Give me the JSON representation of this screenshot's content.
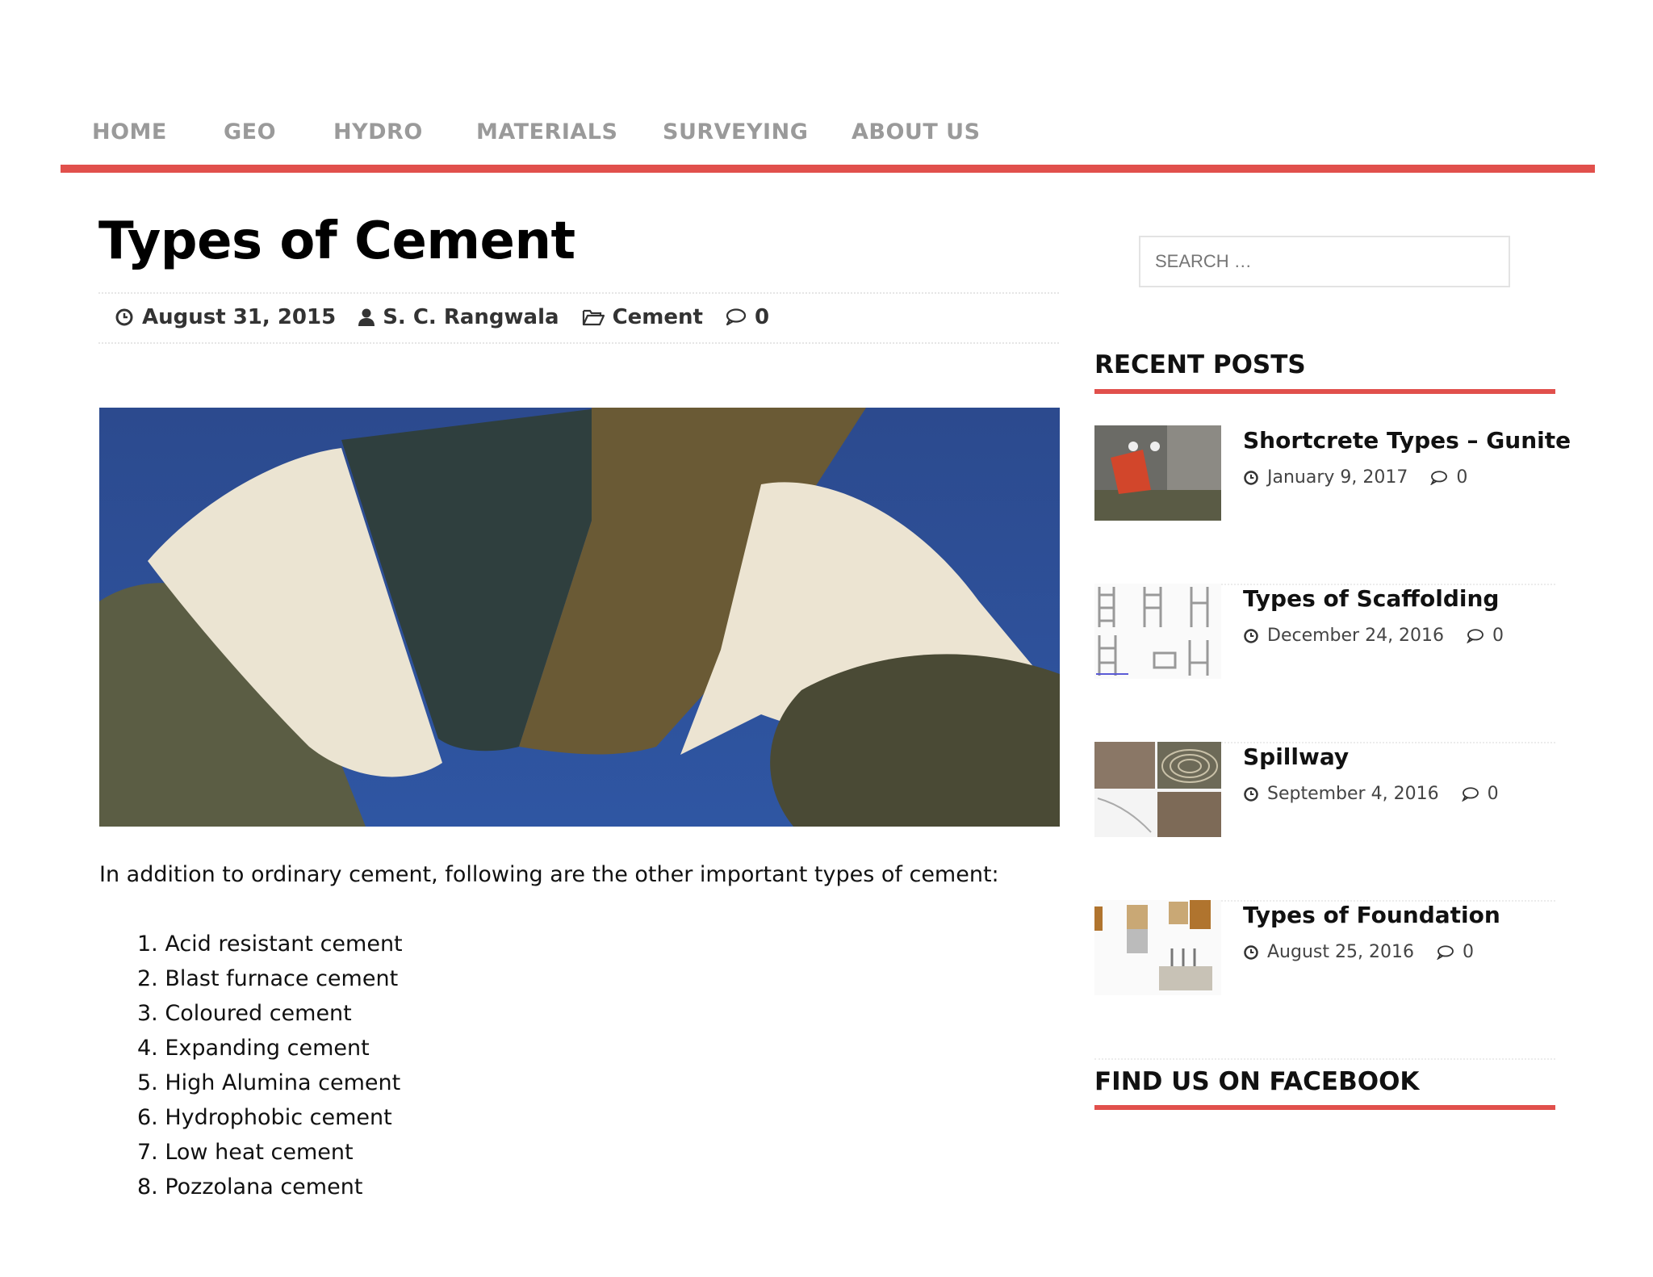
{
  "nav": {
    "items": [
      {
        "label": "HOME"
      },
      {
        "label": "GEO"
      },
      {
        "label": "HYDRO"
      },
      {
        "label": "MATERIALS"
      },
      {
        "label": "SURVEYING"
      },
      {
        "label": "ABOUT US"
      }
    ],
    "accent": "#e1504c"
  },
  "article": {
    "title": "Types of Cement",
    "meta": {
      "date": "August 31, 2015",
      "author": "S. C. Rangwala",
      "category": "Cement",
      "comments": "0"
    },
    "intro": "In addition to ordinary cement, following are the other important types of cement:",
    "list": [
      "1. Acid resistant cement",
      "2. Blast furnace cement",
      "3. Coloured cement",
      "4. Expanding cement",
      "5. High Alumina cement",
      "6. Hydrophobic cement",
      "7. Low heat cement",
      "8. Pozzolana cement"
    ]
  },
  "sidebar": {
    "search_placeholder": "SEARCH …",
    "recent_title": "RECENT POSTS",
    "posts": [
      {
        "title": "Shortcrete Types – Gunite",
        "date": "January 9, 2017",
        "comments": "0"
      },
      {
        "title": "Types of Scaffolding",
        "date": "December 24, 2016",
        "comments": "0"
      },
      {
        "title": "Spillway",
        "date": "September 4, 2016",
        "comments": "0"
      },
      {
        "title": "Types of Foundation",
        "date": "August 25, 2016",
        "comments": "0"
      }
    ],
    "facebook_title": "FIND US ON FACEBOOK"
  }
}
